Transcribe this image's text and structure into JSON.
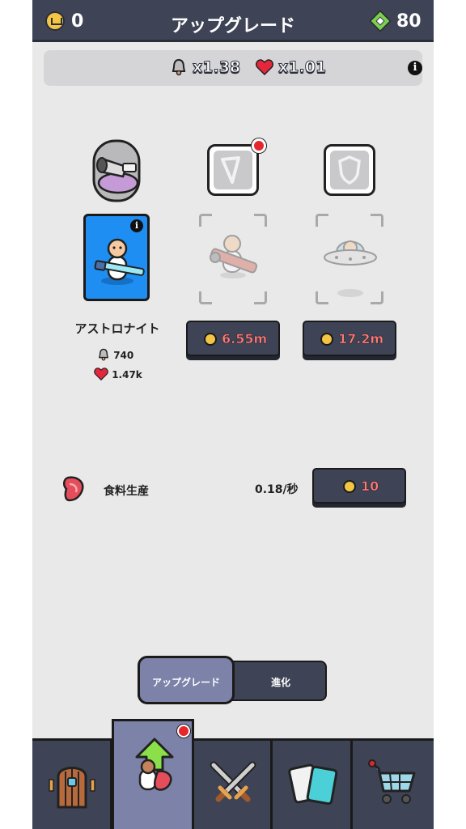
{
  "header": {
    "crowns": "0",
    "title": "アップグレード",
    "gems": "80"
  },
  "multipliers": {
    "bell": "x1.38",
    "heart": "x1.01"
  },
  "character": {
    "name": "アストロナイト",
    "attack": "740",
    "health": "1.47k"
  },
  "upgrades": [
    {
      "price": "6.55m"
    },
    {
      "price": "17.2m"
    }
  ],
  "food": {
    "label": "食料生産",
    "rate": "0.18/秒",
    "price": "10"
  },
  "toggle": {
    "upgrade": "アップグレード",
    "evolve": "進化"
  },
  "nav": {
    "items": [
      "door-icon",
      "upgrade-icon",
      "swords-icon",
      "cards-icon",
      "cart-icon"
    ],
    "active": 1
  },
  "colors": {
    "bar": "#3e4456",
    "accent_blue": "#1e8ef2",
    "price_text": "#ff7a7a",
    "active_tab": "#7c82a8"
  }
}
